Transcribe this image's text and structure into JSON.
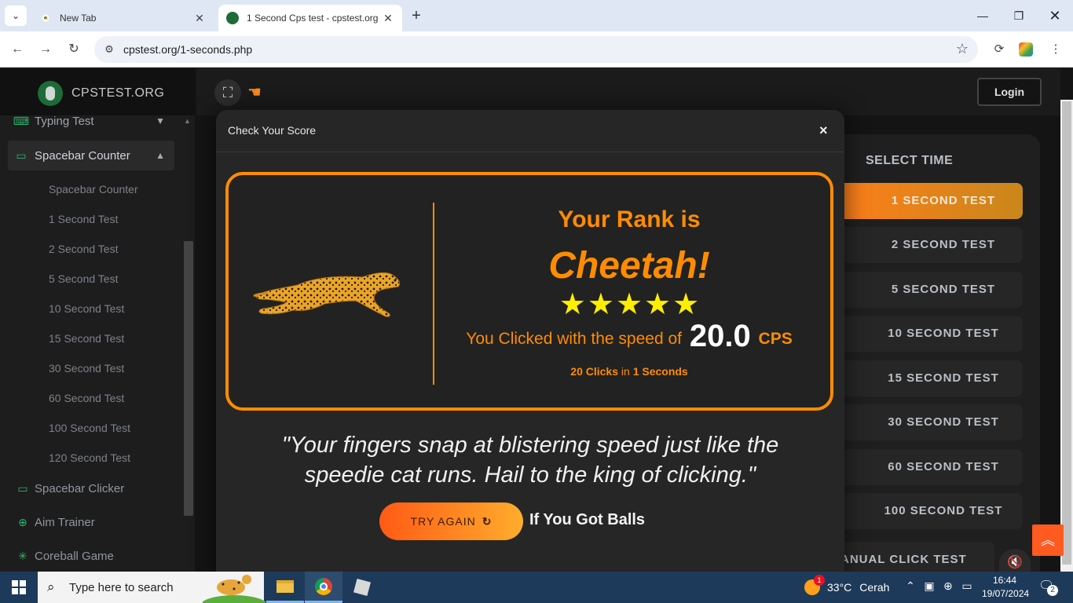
{
  "browser": {
    "tabs": [
      {
        "title": "New Tab"
      },
      {
        "title": "1 Second Cps test - cpstest.org"
      }
    ],
    "url": "cpstest.org/1-seconds.php"
  },
  "site": {
    "brand": "CPSTEST.ORG",
    "login_label": "Login",
    "sidebar": {
      "items": [
        {
          "label": "Typing Test"
        },
        {
          "label": "Spacebar Counter"
        }
      ],
      "subitems": [
        "Spacebar Counter",
        "1 Second Test",
        "2 Second Test",
        "5 Second Test",
        "10 Second Test",
        "15 Second Test",
        "30 Second Test",
        "60 Second Test",
        "100 Second Test",
        "120 Second Test"
      ],
      "more": [
        {
          "label": "Spacebar Clicker"
        },
        {
          "label": "Aim Trainer"
        },
        {
          "label": "Coreball Game"
        }
      ]
    },
    "select_time": {
      "heading": "SELECT TIME",
      "options": [
        "1 SECOND TEST",
        "2 SECOND TEST",
        "5 SECOND TEST",
        "10 SECOND TEST",
        "15 SECOND TEST",
        "30 SECOND TEST",
        "60 SECOND TEST",
        "100 SECOND TEST",
        "ANUAL CLICK TEST"
      ]
    }
  },
  "modal": {
    "title": "Check Your Score",
    "close": "×",
    "rank_label": "Your Rank is",
    "rank_value": "Cheetah!",
    "stars": 5,
    "speed_prefix": "You Clicked with the speed of",
    "cps_value": "20.0",
    "cps_unit": "CPS",
    "clicks_count": "20 Clicks",
    "clicks_in": "in",
    "clicks_time": "1 Seconds",
    "quote": "\"Your fingers snap at blistering speed just like the speedie cat runs. Hail to the king of clicking.\"",
    "try_again": "TRY AGAIN",
    "balls_text": "If You Got Balls"
  },
  "colors": {
    "accent": "#ff8c00",
    "star": "#ffee00",
    "sidebar_icon": "#2fb36f"
  },
  "taskbar": {
    "search_placeholder": "Type here to search",
    "weather_temp": "33°C",
    "weather_text": "Cerah",
    "weather_badge": "1",
    "time": "16:44",
    "date": "19/07/2024",
    "notifications": "2"
  }
}
